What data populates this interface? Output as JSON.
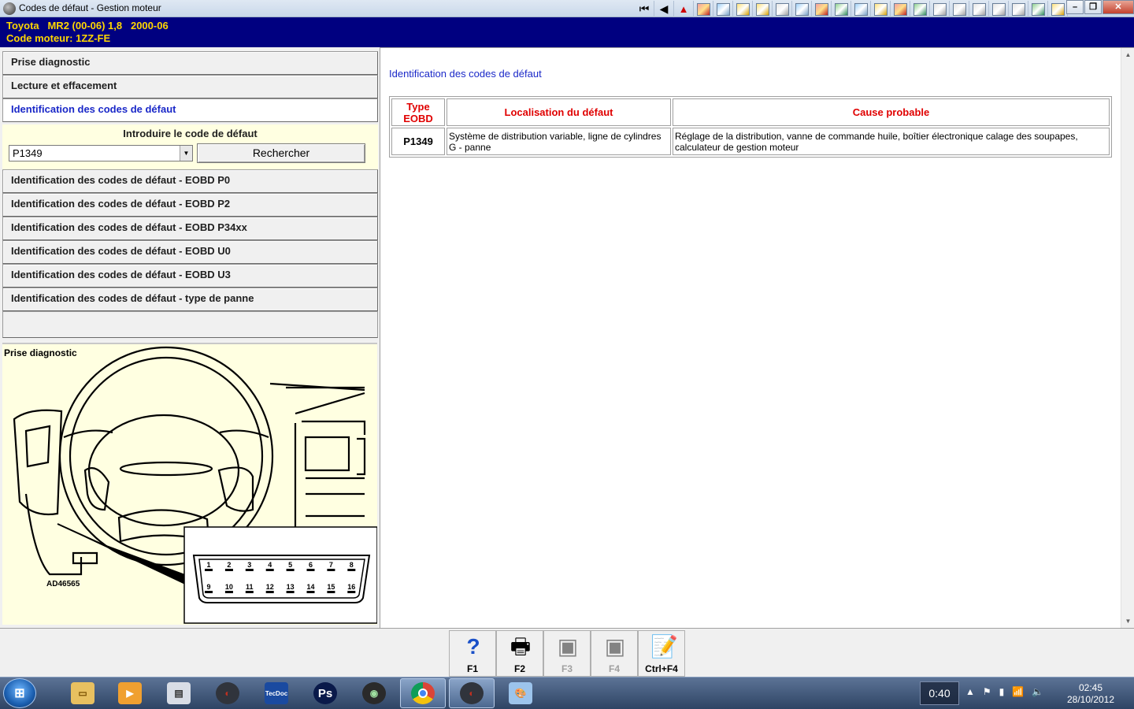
{
  "window": {
    "title": "Codes de défaut - Gestion moteur",
    "controls": [
      "–",
      "❐",
      "✕"
    ]
  },
  "toolbar": {
    "icons": [
      "first-icon",
      "prev-icon",
      "warning-icon",
      "component-icon",
      "car-icon",
      "gear-icon",
      "tools-icon",
      "dial-icon",
      "lift-icon",
      "brake-icon",
      "door-icon",
      "service-icon",
      "spark-icon",
      "bug-icon",
      "battery-icon",
      "tyre-icon",
      "belt-icon",
      "timing-icon",
      "light-icon",
      "triangle-icon",
      "car-repair-icon",
      "document-icon"
    ]
  },
  "vehicle": {
    "line1": "Toyota   MR2 (00-06) 1,8   2000-06",
    "line2": "Code moteur: 1ZZ-FE"
  },
  "nav": {
    "items": [
      {
        "label": "Prise diagnostic"
      },
      {
        "label": "Lecture et effacement"
      },
      {
        "label": "Identification des codes de défaut"
      }
    ],
    "sub_items": [
      {
        "label": "Identification des codes de défaut - EOBD P0"
      },
      {
        "label": "Identification des codes de défaut - EOBD P2"
      },
      {
        "label": "Identification des codes de défaut - EOBD P34xx"
      },
      {
        "label": "Identification des codes de défaut - EOBD U0"
      },
      {
        "label": "Identification des codes de défaut - EOBD U3"
      },
      {
        "label": "Identification des codes de défaut - type de panne"
      }
    ]
  },
  "search": {
    "label": "Introduire le code de défaut",
    "value": "P1349",
    "button": "Rechercher"
  },
  "diagram": {
    "title": "Prise diagnostic",
    "ref": "AD46565",
    "pins_top": [
      "1",
      "2",
      "3",
      "4",
      "5",
      "6",
      "7",
      "8"
    ],
    "pins_bottom": [
      "9",
      "10",
      "11",
      "12",
      "13",
      "14",
      "15",
      "16"
    ]
  },
  "content": {
    "title": "Identification des codes de défaut",
    "table": {
      "headers": [
        "Type EOBD",
        "Localisation du défaut",
        "Cause probable"
      ],
      "rows": [
        {
          "code": "P1349",
          "location": "Système de distribution variable, ligne de cylindres G - panne",
          "cause": "Réglage de la distribution, vanne de commande huile, boîtier électronique calage des soupapes, calculateur de gestion moteur"
        }
      ]
    }
  },
  "fkeys": [
    {
      "label": "F1",
      "icon": "help-icon",
      "enabled": true
    },
    {
      "label": "F2",
      "icon": "print-icon",
      "enabled": true
    },
    {
      "label": "F3",
      "icon": "images-icon",
      "enabled": false
    },
    {
      "label": "F4",
      "icon": "images-icon",
      "enabled": false
    },
    {
      "label": "Ctrl+F4",
      "icon": "notes-icon",
      "enabled": true
    }
  ],
  "taskbar": {
    "apps": [
      "explorer",
      "media-player",
      "document",
      "autodata",
      "tecdoc",
      "photoshop",
      "itunes",
      "chrome",
      "autodata-active",
      "paint"
    ],
    "timer": "0:40",
    "time": "02:45",
    "date": "28/10/2012"
  },
  "colors": {
    "header_bg": "#000080",
    "header_text": "#ffd700",
    "link_blue": "#1a28c8",
    "table_header_red": "#e00000",
    "panel_yellow": "#ffffe1"
  }
}
